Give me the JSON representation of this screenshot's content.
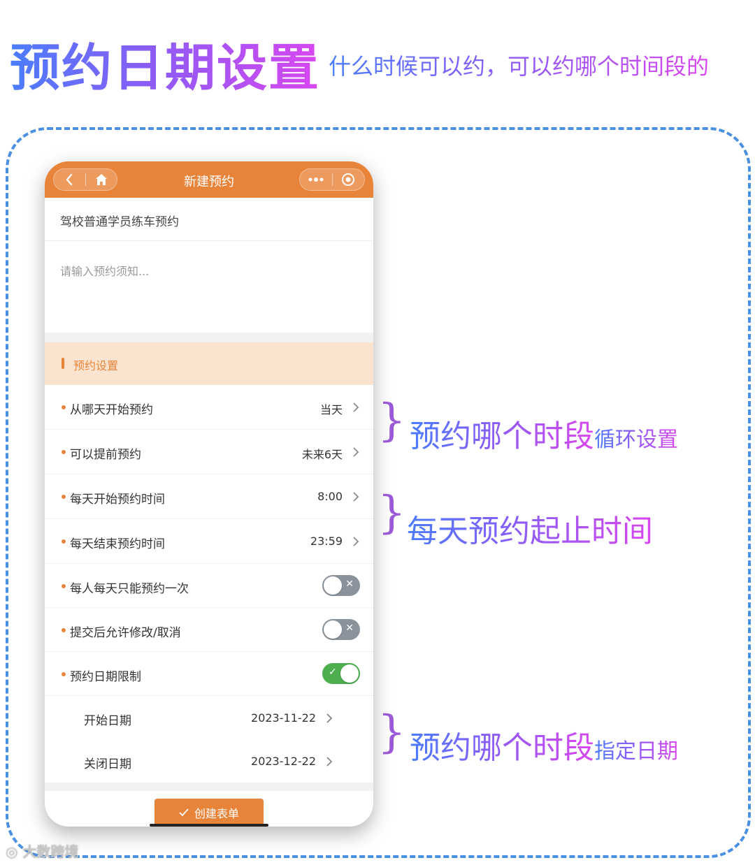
{
  "header": {
    "title": "预约日期设置",
    "subtitle": "什么时候可以约，可以约哪个时间段的"
  },
  "phone": {
    "nav": {
      "title": "新建预约",
      "back_icon": "chevron-left-icon",
      "home_icon": "home-icon",
      "more_icon": "ellipsis-icon",
      "record_icon": "target-icon"
    },
    "form_title": "驾校普通学员练车预约",
    "notice_placeholder": "请输入预约须知...",
    "section_label": "预约设置",
    "rows": [
      {
        "label": "从哪天开始预约",
        "value": "当天"
      },
      {
        "label": "可以提前预约",
        "value": "未来6天"
      },
      {
        "label": "每天开始预约时间",
        "value": "8:00"
      },
      {
        "label": "每天结束预约时间",
        "value": "23:59"
      }
    ],
    "toggles": [
      {
        "label": "每人每天只能预约一次",
        "state": "off"
      },
      {
        "label": "提交后允许修改/取消",
        "state": "off"
      },
      {
        "label": "预约日期限制",
        "state": "on"
      }
    ],
    "date_rows": [
      {
        "label": "开始日期",
        "value": "2023-11-22"
      },
      {
        "label": "关闭日期",
        "value": "2023-12-22"
      }
    ],
    "create_button": "创建表单"
  },
  "annotations": [
    {
      "main": "预约哪个时段",
      "sub": "循环设置"
    },
    {
      "main": "每天预约起止时间",
      "sub": ""
    },
    {
      "main": "预约哪个时段",
      "sub": "指定日期"
    }
  ],
  "watermark": "大数跨境",
  "colors": {
    "accent": "#e8843a",
    "section_bg": "#fbe4cf",
    "toggle_on": "#4cae4f",
    "toggle_off": "#8a939c",
    "frame": "#4a90e2"
  }
}
